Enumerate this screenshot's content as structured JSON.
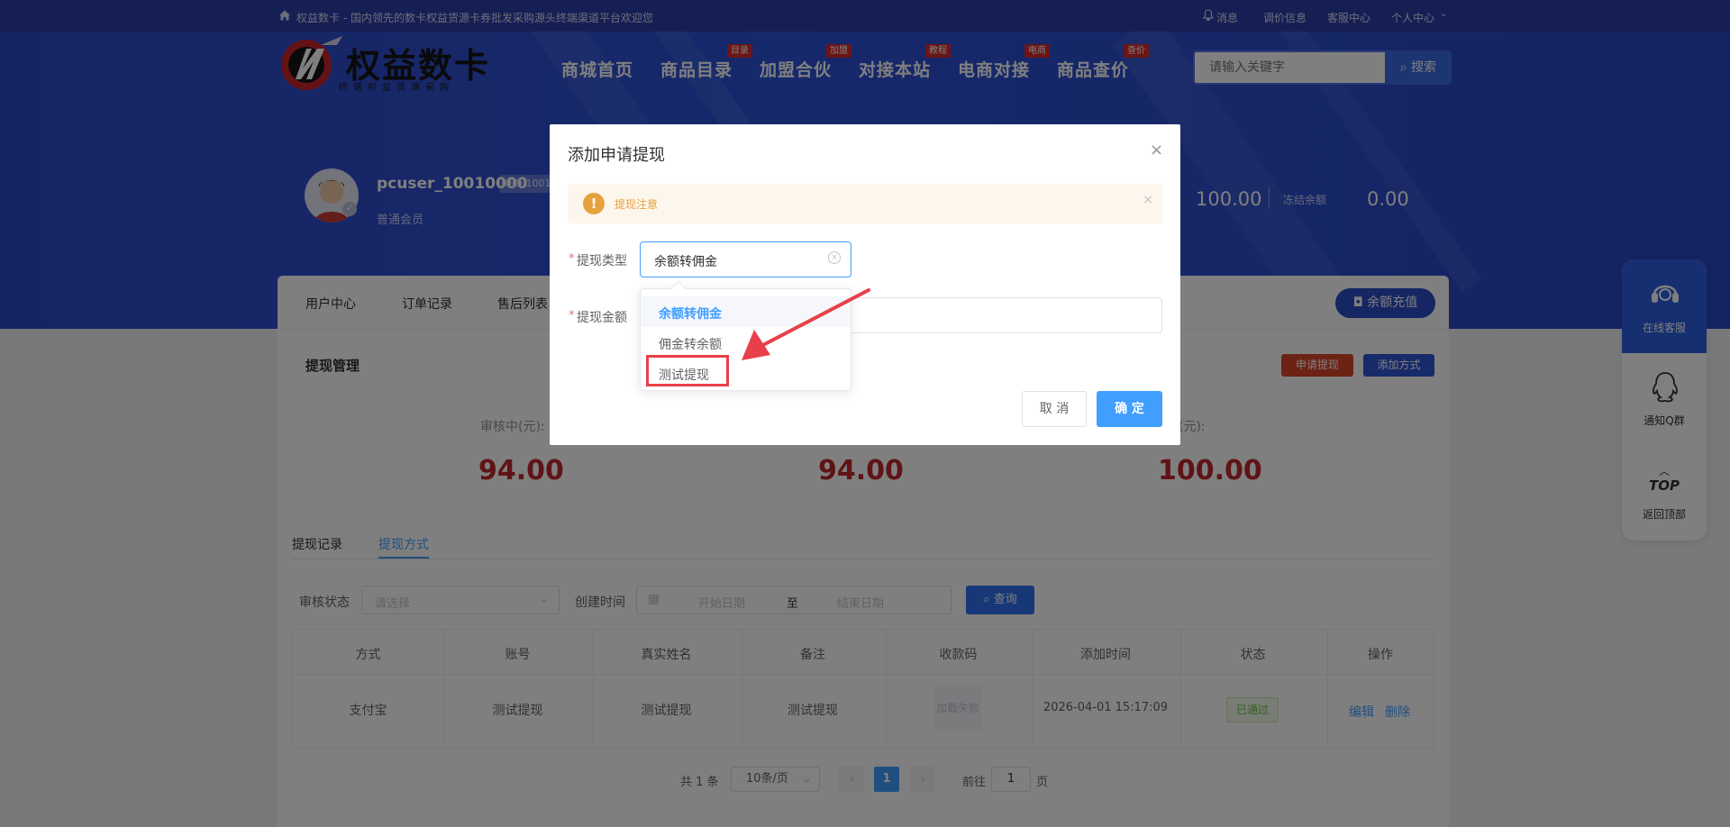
{
  "topbar": {
    "site_text": "权益数卡 - 国内领先的数卡权益货源卡券批发采购源头终端渠道平台欢迎您",
    "links": [
      "消息",
      "调价信息",
      "客服中心",
      "个人中心"
    ]
  },
  "logo": {
    "text": "权益数卡",
    "sub": "终端权益货源采购"
  },
  "nav": {
    "items": [
      {
        "label": "商城首页",
        "badge": ""
      },
      {
        "label": "商品目录",
        "badge": "目录"
      },
      {
        "label": "加盟合伙",
        "badge": "加盟"
      },
      {
        "label": "对接本站",
        "badge": "教程"
      },
      {
        "label": "电商对接",
        "badge": "电商"
      },
      {
        "label": "商品查价",
        "badge": "查价"
      }
    ]
  },
  "search": {
    "placeholder": "请输入关键字",
    "button": "搜索"
  },
  "user": {
    "name": "pcuser_10010000",
    "uid": "UID:10010000",
    "level": "普通会员",
    "balance": "100.00",
    "frozen_label": "冻结余额",
    "frozen_value": "0.00"
  },
  "tabs": {
    "items": [
      "用户中心",
      "订单记录",
      "售后列表"
    ],
    "recharge": "余额充值"
  },
  "withdraw": {
    "title": "提现管理",
    "apply_btn": "申请提现",
    "add_method_btn": "添加方式",
    "stats": [
      {
        "label": "审核中(元):",
        "value": "94.00"
      },
      {
        "label": "",
        "value": "94.00"
      },
      {
        "label": "余可提(元):",
        "value": "100.00"
      }
    ],
    "subtabs": [
      "提现记录",
      "提现方式"
    ],
    "filter": {
      "status_label": "审核状态",
      "status_placeholder": "请选择",
      "time_label": "创建时间",
      "start_placeholder": "开始日期",
      "to": "至",
      "end_placeholder": "结束日期",
      "query": "查询"
    },
    "table": {
      "headers": [
        "方式",
        "账号",
        "真实姓名",
        "备注",
        "收款码",
        "添加时间",
        "状态",
        "操作"
      ],
      "rows": [
        {
          "method": "支付宝",
          "account": "测试提现",
          "name": "测试提现",
          "remark": "测试提现",
          "qr": "加载失败",
          "time": "2026-04-01 15:17:09",
          "status": "已通过",
          "edit": "编辑",
          "del": "删除"
        }
      ]
    },
    "pagination": {
      "total": "共 1 条",
      "size": "10条/页",
      "current": "1",
      "goto": "前往",
      "page_input": "1",
      "page_unit": "页"
    }
  },
  "sidebar": {
    "service": "在线客服",
    "qq": "通知Q群",
    "top_glyph": "TOP",
    "top": "返回顶部"
  },
  "dialog": {
    "title": "添加申请提现",
    "alert": "提现注意",
    "type_label": "提现类型",
    "type_value": "余额转佣金",
    "amount_label": "提现金额",
    "options": [
      "余额转佣金",
      "佣金转余额",
      "测试提现"
    ],
    "cancel": "取 消",
    "confirm": "确 定"
  },
  "colors": {
    "primary": "#409eff",
    "danger": "#c0272d",
    "annotation": "#e8404a",
    "banner": "#2d52d8"
  }
}
